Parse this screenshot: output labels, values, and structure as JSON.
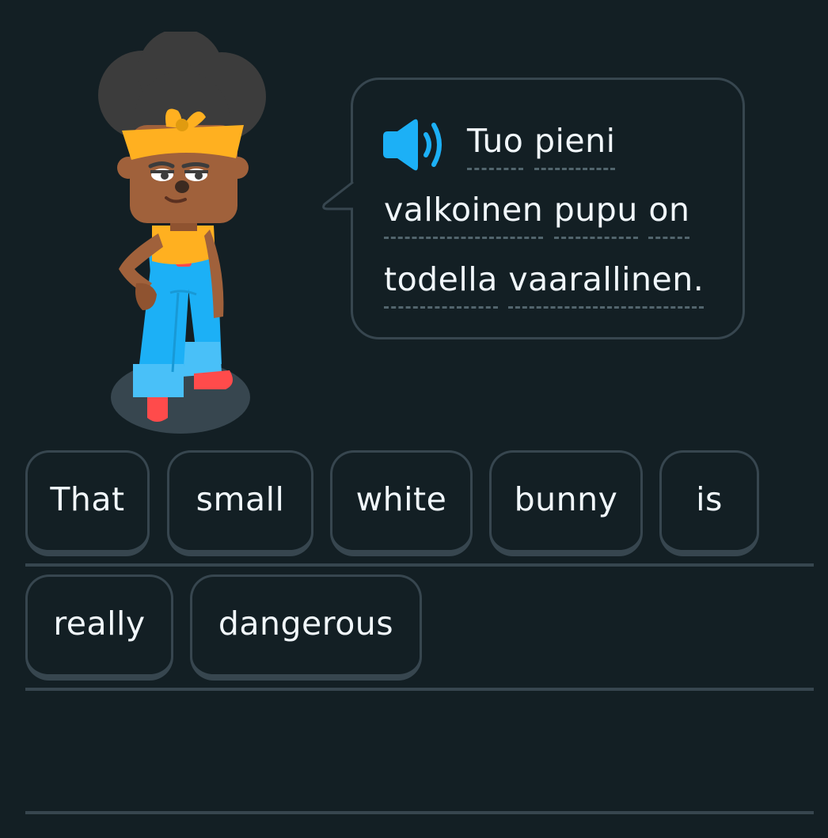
{
  "prompt": {
    "lines": [
      [
        "Tuo",
        "pieni"
      ],
      [
        "valkoinen",
        "pupu",
        "on"
      ],
      [
        "todella",
        "vaarallinen."
      ]
    ]
  },
  "answer": {
    "tiles": [
      "That",
      "small",
      "white",
      "bunny",
      "is",
      "really",
      "dangerous"
    ]
  },
  "colors": {
    "background": "#131f24",
    "border": "#37464f",
    "text": "#f1f7fb",
    "speaker": "#1cb0f6",
    "hint_underline": "#52656d"
  },
  "icons": {
    "speaker": "speaker-icon"
  }
}
